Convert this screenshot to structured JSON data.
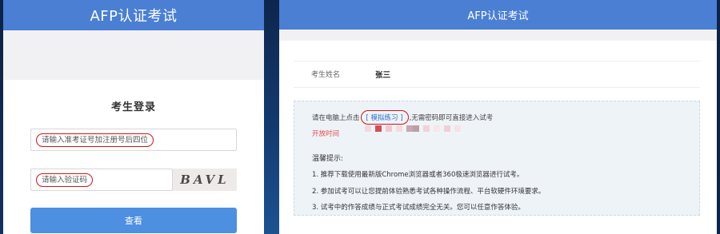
{
  "left": {
    "header_title": "AFP认证考试",
    "login_title": "考生登录",
    "ticket_placeholder": "请输入准考证号加注册号后四位",
    "captcha_placeholder": "请输入验证码",
    "captcha_text": "BAVL",
    "submit_label": "查看"
  },
  "right": {
    "header_title": "AFP认证考试",
    "name_label": "考生姓名",
    "name_value": "张三",
    "click_prefix": "请在电脑上点击",
    "practice_link": "[ 模拟练习 ]",
    "click_suffix": ",无需密码即可直接进入试考",
    "exam_code_label": "开放时间",
    "tips_title": "温馨提示:",
    "tips": [
      "1. 推荐下载使用最新版Chrome浏览器或者360极速浏览器进行试考。",
      "2. 参加试考可以让您提前体验熟悉考试各种操作流程、平台软硬件环境要求。",
      "3. 试考中的作答成绩与正式考试成绩完全无关。您可以任意作答体验。"
    ]
  },
  "colors": {
    "header": "#4a7fd4",
    "button": "#4d8fe0",
    "annotation": "#d21414",
    "link": "#2f6fd0"
  }
}
